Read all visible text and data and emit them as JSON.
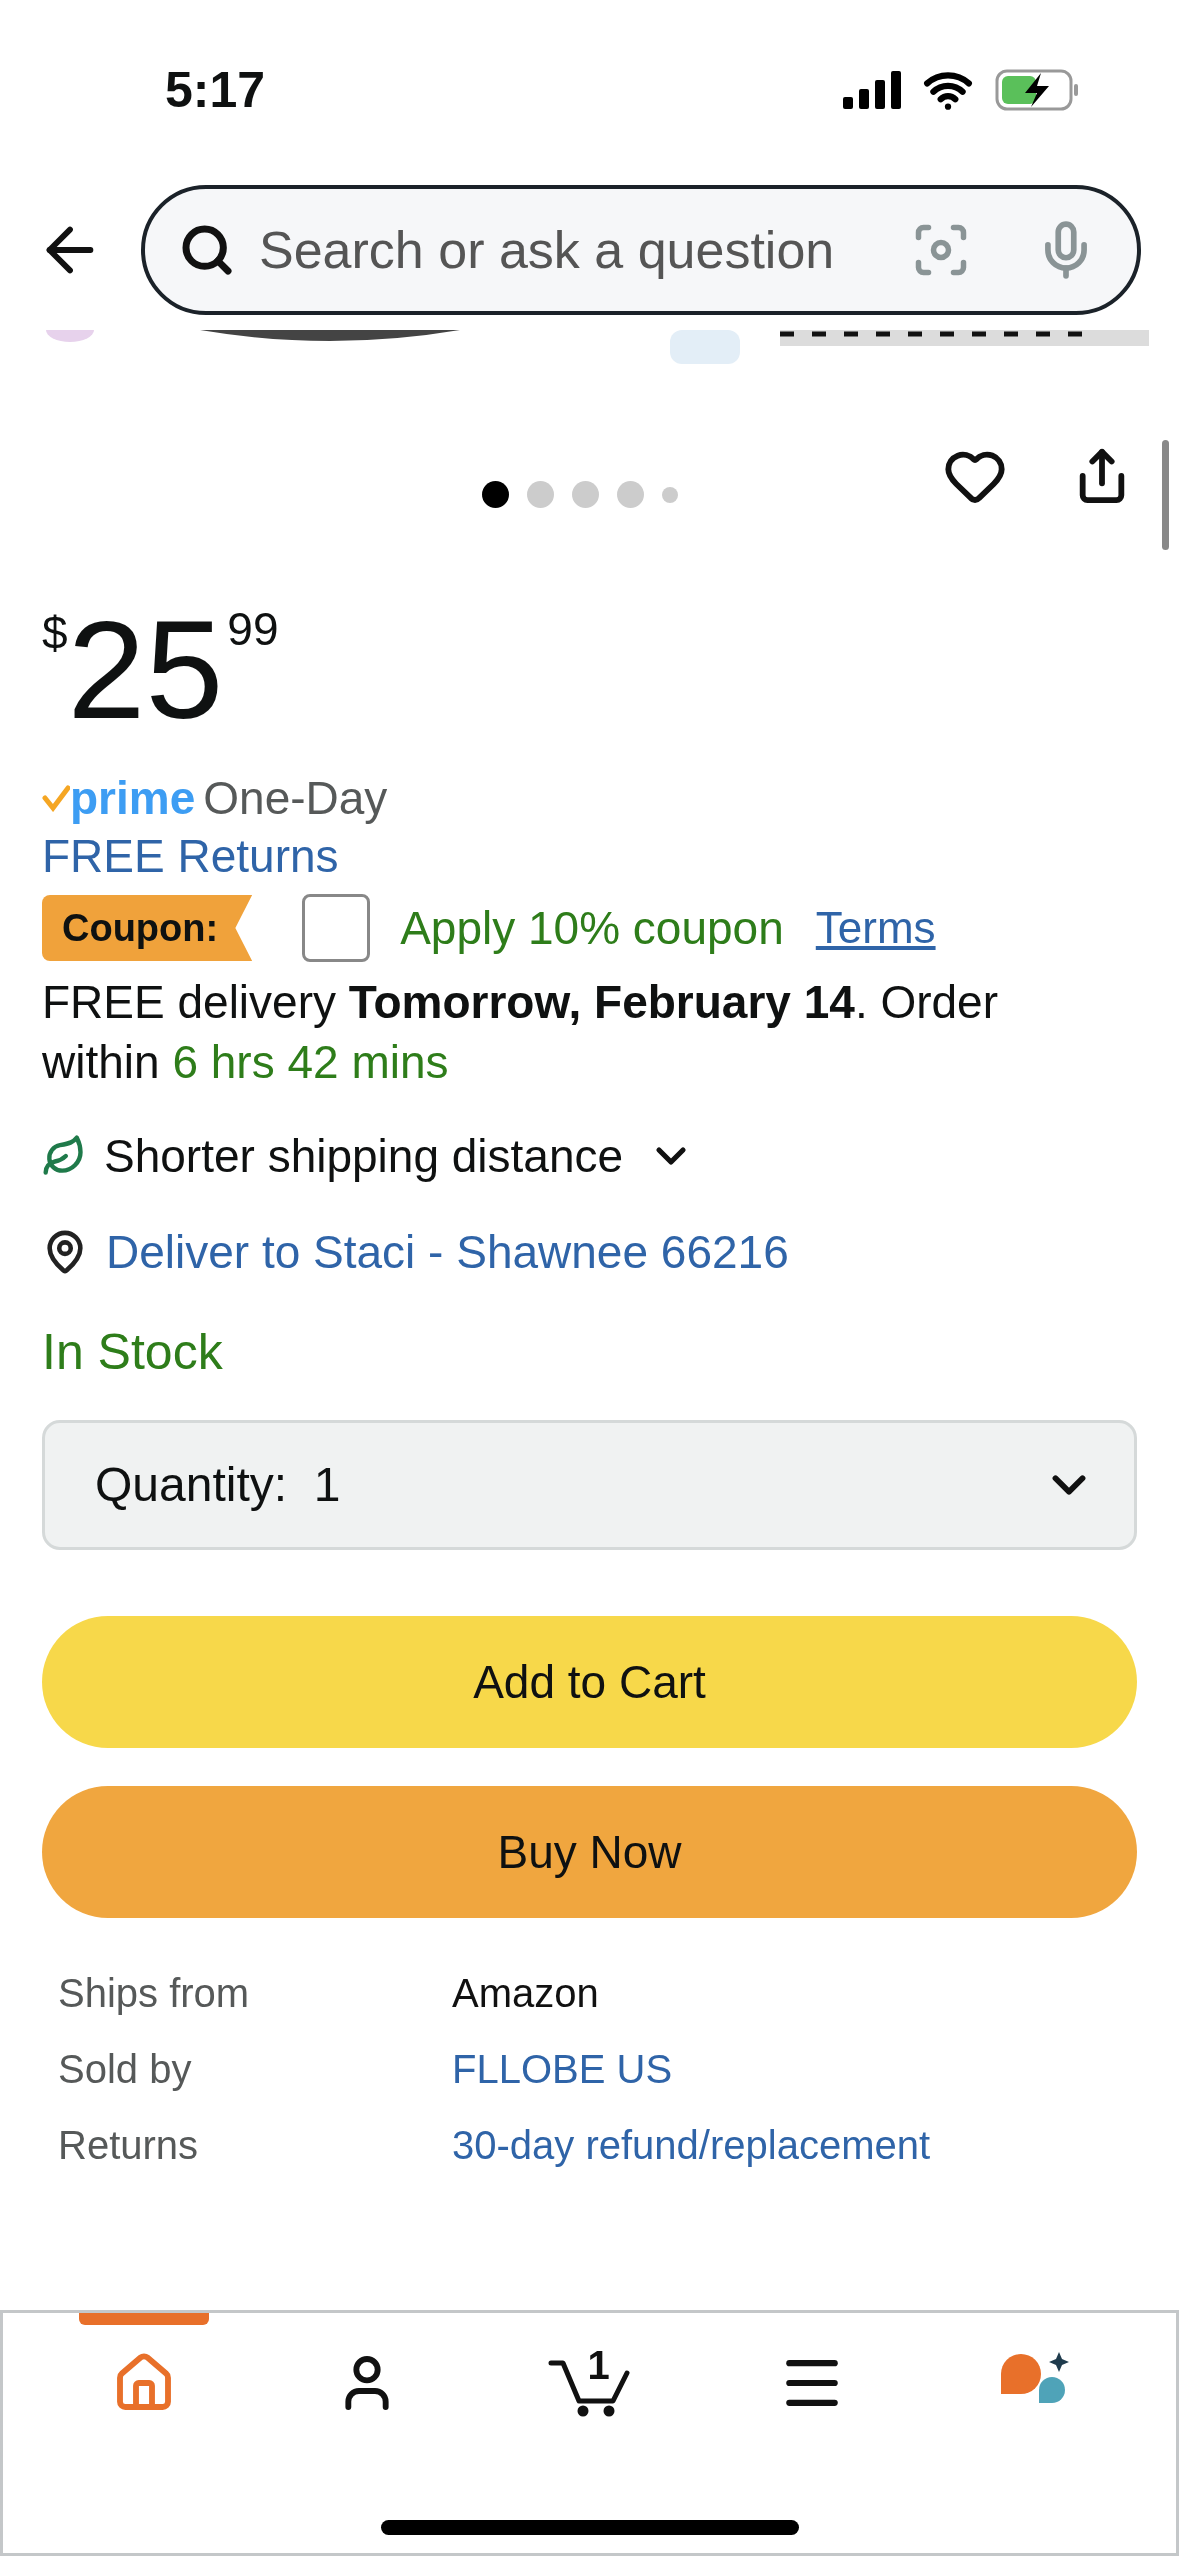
{
  "status_bar": {
    "time": "5:17"
  },
  "search": {
    "placeholder": "Search or ask a question"
  },
  "gallery": {
    "dots": [
      {
        "selected": true
      },
      {
        "selected": false
      },
      {
        "selected": false
      },
      {
        "selected": false
      },
      {
        "selected": false
      }
    ]
  },
  "price": {
    "currency": "$",
    "whole": "25",
    "fraction": "99"
  },
  "prime": {
    "logo": "prime",
    "speed": "One-Day"
  },
  "free_returns": "FREE Returns",
  "coupon": {
    "label": "Coupon:",
    "checked": false,
    "text": "Apply 10% coupon",
    "link": "Terms"
  },
  "delivery": {
    "prefix": "FREE delivery",
    "date": "Tomorrow, February 14",
    "middle": ". Order within",
    "countdown": "6 hrs 42 mins"
  },
  "shipping_note": "Shorter shipping distance",
  "deliver_to": "Deliver to Staci - Shawnee 66216",
  "stock": "In Stock",
  "quantity": {
    "label": "Quantity:",
    "value": "1"
  },
  "buttons": [
    {
      "label": "Add to Cart",
      "kind": "add"
    },
    {
      "label": "Buy Now",
      "kind": "buy"
    }
  ],
  "details": [
    {
      "label": "Ships from",
      "value": "Amazon",
      "kind": "text"
    },
    {
      "label": "Sold by",
      "value": "FLLOBE US",
      "kind": "link"
    },
    {
      "label": "Returns",
      "value": "30-day refund/replacement",
      "kind": "link"
    }
  ],
  "nav": [
    {
      "kind": "home",
      "selected": true
    },
    {
      "kind": "account",
      "selected": false
    },
    {
      "kind": "cart",
      "badge": "1",
      "selected": false
    },
    {
      "kind": "menu",
      "selected": false
    },
    {
      "kind": "assistant",
      "selected": false
    }
  ]
}
